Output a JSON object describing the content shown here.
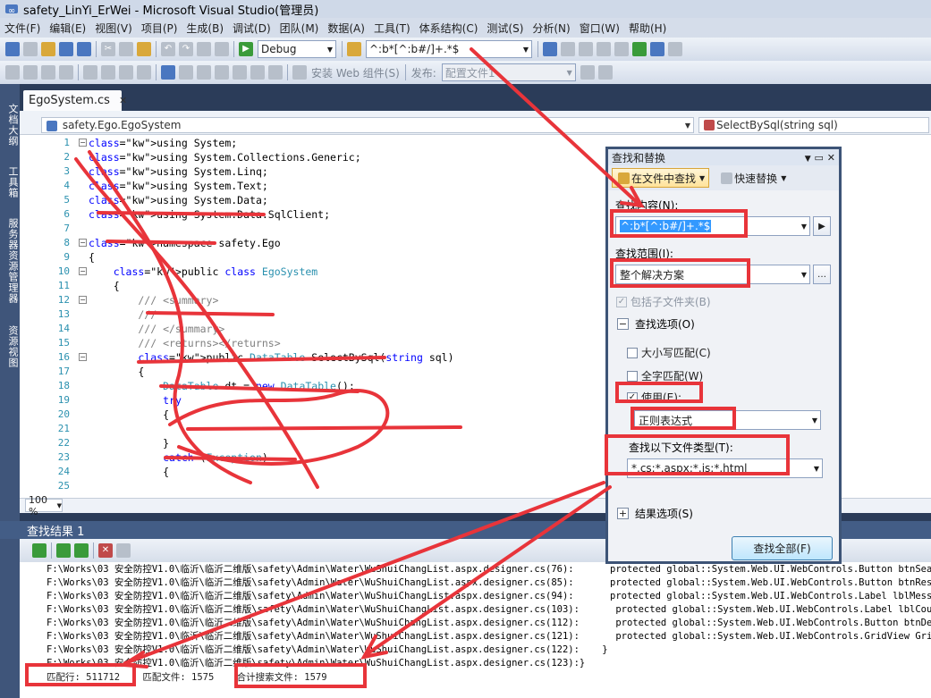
{
  "window": {
    "title": "safety_LinYi_ErWei - Microsoft Visual Studio(管理员)"
  },
  "menu": [
    "文件(F)",
    "编辑(E)",
    "视图(V)",
    "项目(P)",
    "生成(B)",
    "调试(D)",
    "团队(M)",
    "数据(A)",
    "工具(T)",
    "体系结构(C)",
    "测试(S)",
    "分析(N)",
    "窗口(W)",
    "帮助(H)"
  ],
  "toolbar": {
    "config": "Debug",
    "search_value": "^:b*[^:b#/]+.*$",
    "install_label": "安装 Web 组件(S)",
    "publish_label": "发布:",
    "publish_profile": "配置文件1"
  },
  "left_dock": [
    "文档大纲",
    "工具箱",
    "服务器资源管理器",
    "资源视图"
  ],
  "document": {
    "tab": "EgoSystem.cs",
    "nav_left": "safety.Ego.EgoSystem",
    "nav_right": "SelectBySql(string sql)",
    "zoom": "100 %"
  },
  "code_lines": [
    {
      "n": "1",
      "fold": "−",
      "text": "using System;"
    },
    {
      "n": "2",
      "text": "using System.Collections.Generic;"
    },
    {
      "n": "3",
      "text": "using System.Linq;"
    },
    {
      "n": "4",
      "text": "using System.Text;"
    },
    {
      "n": "5",
      "text": "using System.Data;"
    },
    {
      "n": "6",
      "text": "using System.Data.SqlClient;"
    },
    {
      "n": "7",
      "text": ""
    },
    {
      "n": "8",
      "fold": "−",
      "text": "namespace safety.Ego"
    },
    {
      "n": "9",
      "text": "{"
    },
    {
      "n": "10",
      "fold": "−",
      "text": "    public class EgoSystem"
    },
    {
      "n": "11",
      "text": "    {"
    },
    {
      "n": "12",
      "fold": "−",
      "text": "        /// <summary>"
    },
    {
      "n": "13",
      "text": "        /// "
    },
    {
      "n": "14",
      "text": "        /// </summary>"
    },
    {
      "n": "15",
      "text": "        /// <returns></returns>"
    },
    {
      "n": "16",
      "fold": "−",
      "text": "        public DataTable SelectBySql(string sql)"
    },
    {
      "n": "17",
      "text": "        {"
    },
    {
      "n": "18",
      "text": "            DataTable dt = new DataTable();"
    },
    {
      "n": "19",
      "text": "            try"
    },
    {
      "n": "20",
      "text": "            {"
    },
    {
      "n": "21",
      "text": "                "
    },
    {
      "n": "22",
      "text": "            }"
    },
    {
      "n": "23",
      "text": "            catch (Exception)"
    },
    {
      "n": "24",
      "text": "            {"
    },
    {
      "n": "25",
      "text": "                "
    }
  ],
  "results": {
    "title": "查找结果 1",
    "lines_left": [
      "F:\\Works\\03 安全防控V1.0\\临沂\\临沂二维版\\safety\\Admin\\Water\\WuShuiChangList.aspx.designer.cs(76):",
      "F:\\Works\\03 安全防控V1.0\\临沂\\临沂二维版\\safety\\Admin\\Water\\WuShuiChangList.aspx.designer.cs(85):",
      "F:\\Works\\03 安全防控V1.0\\临沂\\临沂二维版\\safety\\Admin\\Water\\WuShuiChangList.aspx.designer.cs(94):",
      "F:\\Works\\03 安全防控V1.0\\临沂\\临沂二维版\\safety\\Admin\\Water\\WuShuiChangList.aspx.designer.cs(103):",
      "F:\\Works\\03 安全防控V1.0\\临沂\\临沂二维版\\safety\\Admin\\Water\\WuShuiChangList.aspx.designer.cs(112):",
      "F:\\Works\\03 安全防控V1.0\\临沂\\临沂二维版\\safety\\Admin\\Water\\WuShuiChangList.aspx.designer.cs(121):",
      "F:\\Works\\03 安全防控V1.0\\临沂\\临沂二维版\\safety\\Admin\\Water\\WuShuiChangList.aspx.designer.cs(122):    }",
      "F:\\Works\\03 安全防控V1.0\\临沂\\临沂二维版\\safety\\Admin\\Water\\WuShuiChangList.aspx.designer.cs(123):}"
    ],
    "lines_right": [
      "protected global::System.Web.UI.WebControls.Button btnSearch",
      "protected global::System.Web.UI.WebControls.Button btnReset;",
      "protected global::System.Web.UI.WebControls.Label lblMess;",
      " protected global::System.Web.UI.WebControls.Label lblCount;",
      " protected global::System.Web.UI.WebControls.Button btnDelet",
      " protected global::System.Web.UI.WebControls.GridView GridVi"
    ],
    "summary_matches": "匹配行: 511712",
    "summary_files": "匹配文件: 1575",
    "summary_total": "合计搜索文件: 1579"
  },
  "find_dialog": {
    "title": "查找和替换",
    "tab_find_in_files": "在文件中查找",
    "tab_quick_replace": "快速替换",
    "find_what_label": "查找内容(N):",
    "find_what_value": "^:b*[^:b#/]+.*$",
    "look_in_label": "查找范围(I):",
    "look_in_value": "整个解决方案",
    "include_subfolders": "包括子文件夹(B)",
    "find_options": "查找选项(O)",
    "match_case": "大小写匹配(C)",
    "match_whole_word": "全字匹配(W)",
    "use_label": "使用(E):",
    "use_value": "正则表达式",
    "file_types_label": "查找以下文件类型(T):",
    "file_types_value": "*.cs;*.aspx;*.js;*.html",
    "result_options": "结果选项(S)",
    "find_all": "查找全部(F)"
  },
  "colors": {
    "annotation": "#e8343a",
    "keyword": "#0000ff",
    "type": "#2b91af",
    "chrome": "#2b3c59"
  }
}
